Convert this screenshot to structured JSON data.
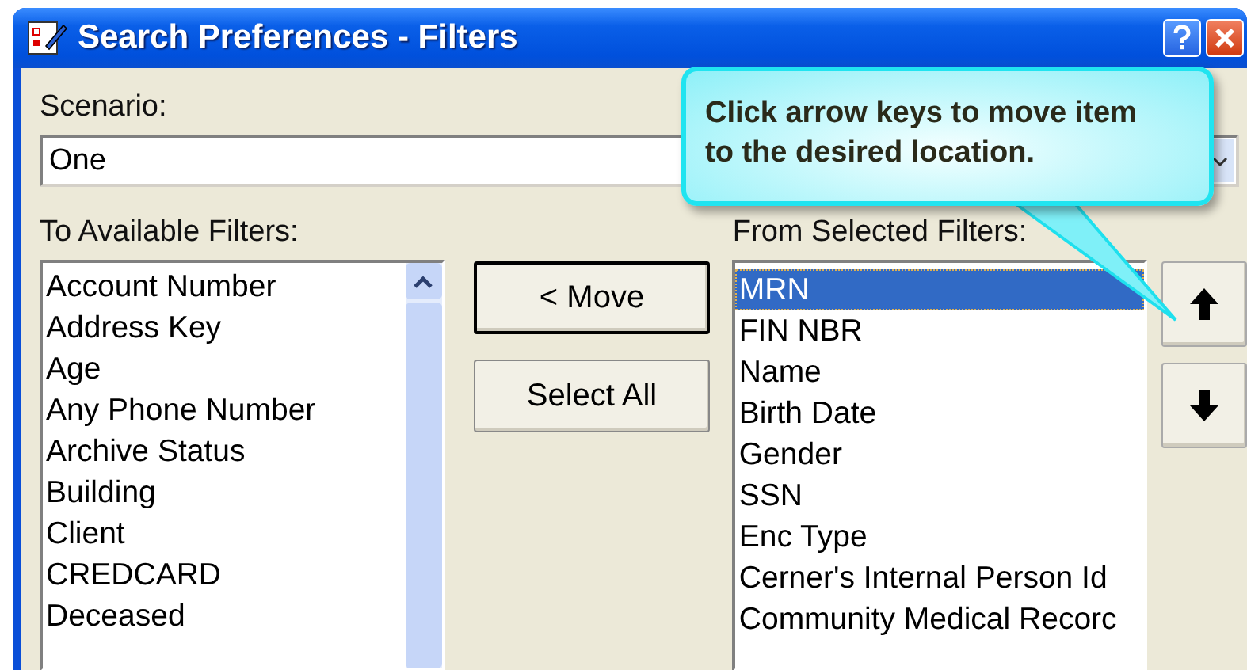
{
  "window": {
    "title": "Search Preferences - Filters"
  },
  "scenario": {
    "label": "Scenario:",
    "value": "One"
  },
  "available": {
    "label": "To Available Filters:",
    "items": [
      {
        "label": "Account Number",
        "selected": false
      },
      {
        "label": "Address Key",
        "selected": false
      },
      {
        "label": "Age",
        "selected": false
      },
      {
        "label": "Any Phone Number",
        "selected": false
      },
      {
        "label": "Archive Status",
        "selected": false
      },
      {
        "label": "Building",
        "selected": false
      },
      {
        "label": "Client",
        "selected": false
      },
      {
        "label": "CREDCARD",
        "selected": false
      },
      {
        "label": "Deceased",
        "selected": false
      }
    ]
  },
  "buttons": [
    "< Move",
    "Select All"
  ],
  "selected_filters": {
    "label": "From Selected Filters:",
    "items": [
      {
        "label": "MRN",
        "selected": true
      },
      {
        "label": "FIN NBR",
        "selected": false
      },
      {
        "label": "Name",
        "selected": false
      },
      {
        "label": "Birth Date",
        "selected": false
      },
      {
        "label": "Gender",
        "selected": false
      },
      {
        "label": "SSN",
        "selected": false
      },
      {
        "label": "Enc Type",
        "selected": false
      },
      {
        "label": "Cerner's Internal Person Id",
        "selected": false
      },
      {
        "label": "Community Medical Recorc",
        "selected": false
      }
    ]
  },
  "callout": {
    "text": "Click arrow keys to move item to the desired location."
  }
}
